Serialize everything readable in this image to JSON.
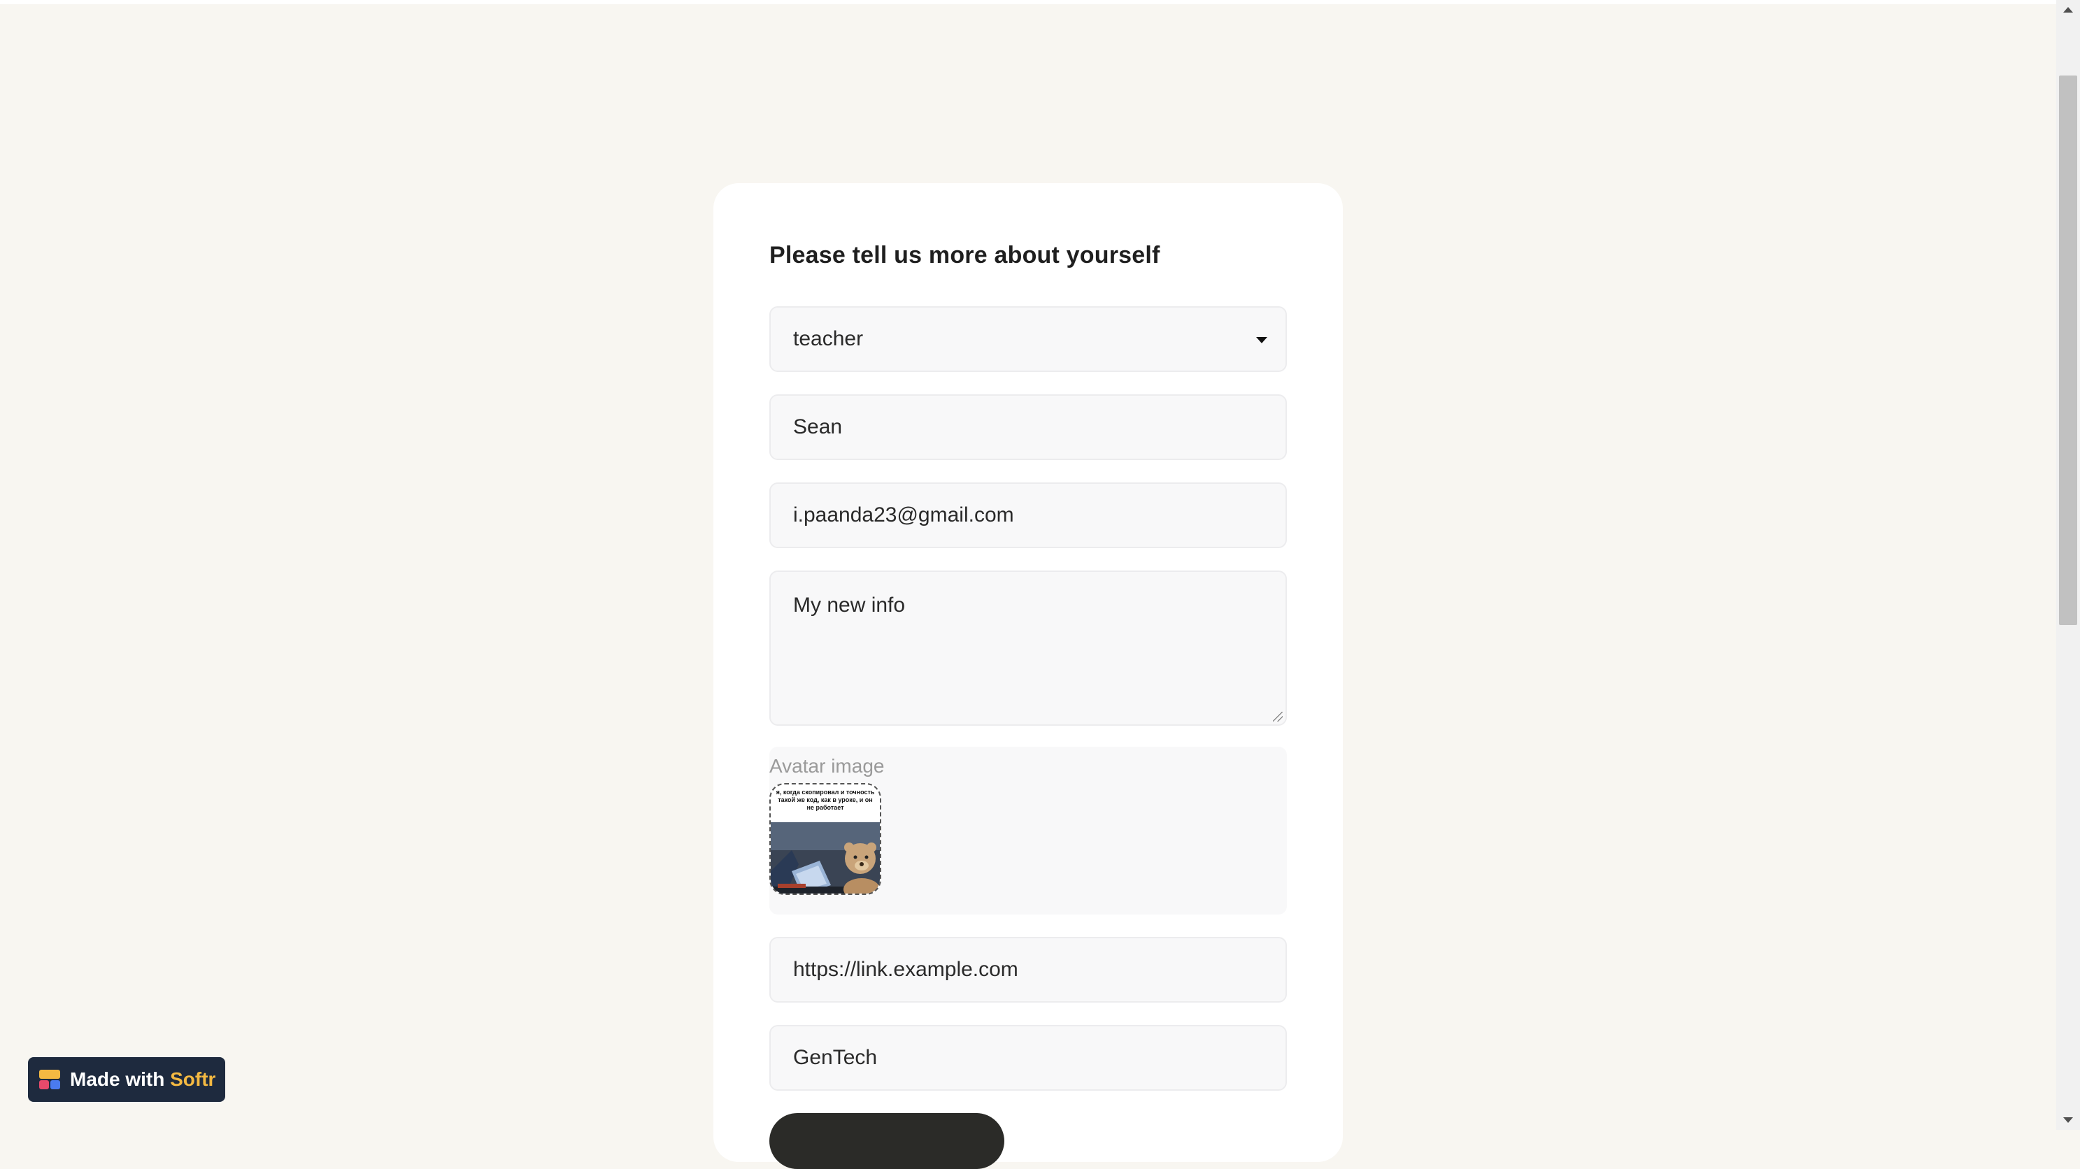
{
  "form": {
    "title": "Please tell us more about yourself",
    "role_select": {
      "value": "teacher",
      "icon": "caret-down-icon"
    },
    "name_field": {
      "value": "Sean"
    },
    "email_field": {
      "value": "i.paanda23@gmail.com"
    },
    "about_field": {
      "value": "My new info"
    },
    "avatar": {
      "label": "Avatar image",
      "image_caption": "я, когда скопировал и точность такой же код, как в уроке, и он не работает"
    },
    "link_field": {
      "value": "https://link.example.com"
    },
    "company_field": {
      "value": "GenTech"
    }
  },
  "badge": {
    "prefix": "Made with",
    "brand": "Softr",
    "icon": "softr-logo-icon"
  },
  "colors": {
    "page_background": "#f8f6f1",
    "card_background": "#ffffff",
    "field_background": "#f8f8f9",
    "button": "#2b2b28",
    "badge_background": "#1e2a3e",
    "badge_brand": "#f4b942"
  }
}
